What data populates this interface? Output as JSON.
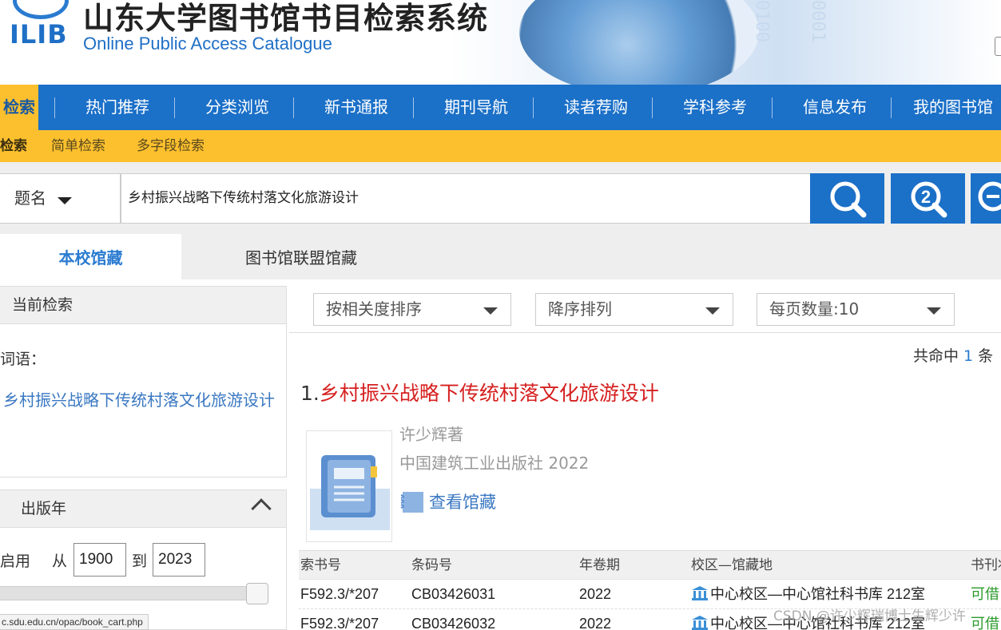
{
  "header": {
    "logo_text": "ILIB",
    "title": "山东大学图书馆书目检索系统",
    "subtitle": "Online Public Access Catalogue"
  },
  "mainnav": {
    "items": [
      "检索",
      "热门推荐",
      "分类浏览",
      "新书通报",
      "期刊导航",
      "读者荐购",
      "学科参考",
      "信息发布",
      "我的图书馆"
    ]
  },
  "subnav": {
    "items": [
      "检索",
      "简单检索",
      "多字段检索"
    ]
  },
  "search": {
    "field": "题名",
    "query": "乡村振兴战略下传统村落文化旅游设计"
  },
  "tabs": {
    "local": "本校馆藏",
    "union": "图书馆联盟馆藏"
  },
  "sidebar": {
    "current_search": {
      "heading": "当前检索",
      "term_label": "词语：",
      "term_value": "乡村振兴战略下传统村落文化旅游设计"
    },
    "pub_year": {
      "heading": "出版年",
      "enable_label": "启用",
      "from_label": "从",
      "from_value": "1900",
      "to_label": "到",
      "to_value": "2023"
    }
  },
  "sort": {
    "by": "按相关度排序",
    "order": "降序排列",
    "page_size": "每页数量:10"
  },
  "hits": {
    "prefix": "共命中",
    "count": "1",
    "suffix": "条"
  },
  "result": {
    "index": "1.",
    "title": "乡村振兴战略下传统村落文化旅游设计",
    "author": "许少辉著",
    "publisher": "中国建筑工业出版社 2022",
    "holdings_link": "查看馆藏"
  },
  "holdings": {
    "columns": [
      "索书号",
      "条码号",
      "年卷期",
      "校区—馆藏地",
      "书刊状态"
    ],
    "rows": [
      {
        "call_no": "F592.3/*207",
        "barcode": "CB03426031",
        "year": "2022",
        "location": "中心校区—中心馆社科书库 212室",
        "status": "可借"
      },
      {
        "call_no": "F592.3/*207",
        "barcode": "CB03426032",
        "year": "2022",
        "location": "中心校区—中心馆社科书库 212室",
        "status": "可借"
      }
    ]
  },
  "status_url": "c.sdu.edu.cn/opac/book_cart.php",
  "watermark": "CSDN @许少辉瑞博士生辉少许",
  "colors": {
    "brand_blue": "#1b70c8",
    "accent_yellow": "#fcc02e",
    "title_red": "#d61f1f",
    "link_blue": "#3a78c2",
    "available_green": "#2b9a2b"
  }
}
